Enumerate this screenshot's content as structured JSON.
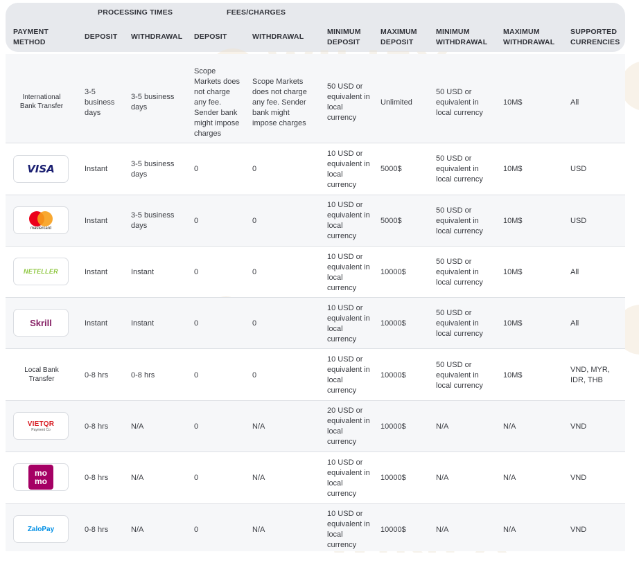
{
  "header": {
    "group_processing": "PROCESSING TIMES",
    "group_fees": "FEES/CHARGES",
    "columns": [
      "PAYMENT METHOD",
      "DEPOSIT",
      "WITHDRAWAL",
      "DEPOSIT",
      "WITHDRAWAL",
      "MINIMUM DEPOSIT",
      "MAXIMUM DEPOSIT",
      "MINIMUM WITHDRAWAL",
      "MAXIMUM WITHDRAWAL",
      "SUPPORTED CURRENCIES"
    ]
  },
  "watermark": "WikiFX",
  "rows": [
    {
      "method": "International Bank Transfer",
      "logo": "",
      "deposit_time": "3-5 business days",
      "withdrawal_time": "3-5 business days",
      "deposit_fee": "Scope Markets does not charge any fee. Sender bank might impose charges",
      "withdrawal_fee": "Scope Markets does not charge any fee. Sender bank might impose charges",
      "min_deposit": "50 USD or equivalent in local currency",
      "max_deposit": "Unlimited",
      "min_withdrawal": "50 USD or equivalent in local currency",
      "max_withdrawal": "10M$",
      "currencies": "All"
    },
    {
      "method": "",
      "logo": "VISA",
      "deposit_time": "Instant",
      "withdrawal_time": "3-5 business days",
      "deposit_fee": "0",
      "withdrawal_fee": "0",
      "min_deposit": "10 USD or equivalent in local currency",
      "max_deposit": "5000$",
      "min_withdrawal": "50 USD or equivalent in local currency",
      "max_withdrawal": "10M$",
      "currencies": "USD"
    },
    {
      "method": "",
      "logo": "mastercard",
      "deposit_time": "Instant",
      "withdrawal_time": "3-5 business days",
      "deposit_fee": "0",
      "withdrawal_fee": "0",
      "min_deposit": "10 USD or equivalent in local currency",
      "max_deposit": "5000$",
      "min_withdrawal": "50 USD or equivalent in local currency",
      "max_withdrawal": "10M$",
      "currencies": "USD"
    },
    {
      "method": "",
      "logo": "NETELLER",
      "deposit_time": "Instant",
      "withdrawal_time": "Instant",
      "deposit_fee": "0",
      "withdrawal_fee": "0",
      "min_deposit": "10 USD or equivalent in local currency",
      "max_deposit": "10000$",
      "min_withdrawal": "50 USD or equivalent in local currency",
      "max_withdrawal": "10M$",
      "currencies": "All"
    },
    {
      "method": "",
      "logo": "Skrill",
      "deposit_time": "Instant",
      "withdrawal_time": "Instant",
      "deposit_fee": "0",
      "withdrawal_fee": "0",
      "min_deposit": "10 USD or equivalent in local currency",
      "max_deposit": "10000$",
      "min_withdrawal": "50 USD or equivalent in local currency",
      "max_withdrawal": "10M$",
      "currencies": "All"
    },
    {
      "method": "Local Bank Transfer",
      "logo": "",
      "deposit_time": "0-8 hrs",
      "withdrawal_time": "0-8 hrs",
      "deposit_fee": "0",
      "withdrawal_fee": "0",
      "min_deposit": "10 USD or equivalent in local currency",
      "max_deposit": "10000$",
      "min_withdrawal": "50 USD or equivalent in local currency",
      "max_withdrawal": "10M$",
      "currencies": "VND, MYR, IDR, THB"
    },
    {
      "method": "",
      "logo": "VIETQR",
      "logo_sub": "Payment Co",
      "deposit_time": "0-8 hrs",
      "withdrawal_time": "N/A",
      "deposit_fee": "0",
      "withdrawal_fee": "N/A",
      "min_deposit": "20 USD or equivalent in local currency",
      "max_deposit": "10000$",
      "min_withdrawal": "N/A",
      "max_withdrawal": "N/A",
      "currencies": "VND"
    },
    {
      "method": "",
      "logo": "mo mo",
      "deposit_time": "0-8 hrs",
      "withdrawal_time": "N/A",
      "deposit_fee": "0",
      "withdrawal_fee": "N/A",
      "min_deposit": "10 USD or equivalent in local currency",
      "max_deposit": "10000$",
      "min_withdrawal": "N/A",
      "max_withdrawal": "N/A",
      "currencies": "VND"
    },
    {
      "method": "",
      "logo": "ZaloPay",
      "deposit_time": "0-8 hrs",
      "withdrawal_time": "N/A",
      "deposit_fee": "0",
      "withdrawal_fee": "N/A",
      "min_deposit": "10 USD or equivalent in local currency",
      "max_deposit": "10000$",
      "min_withdrawal": "N/A",
      "max_withdrawal": "N/A",
      "currencies": "VND"
    }
  ]
}
